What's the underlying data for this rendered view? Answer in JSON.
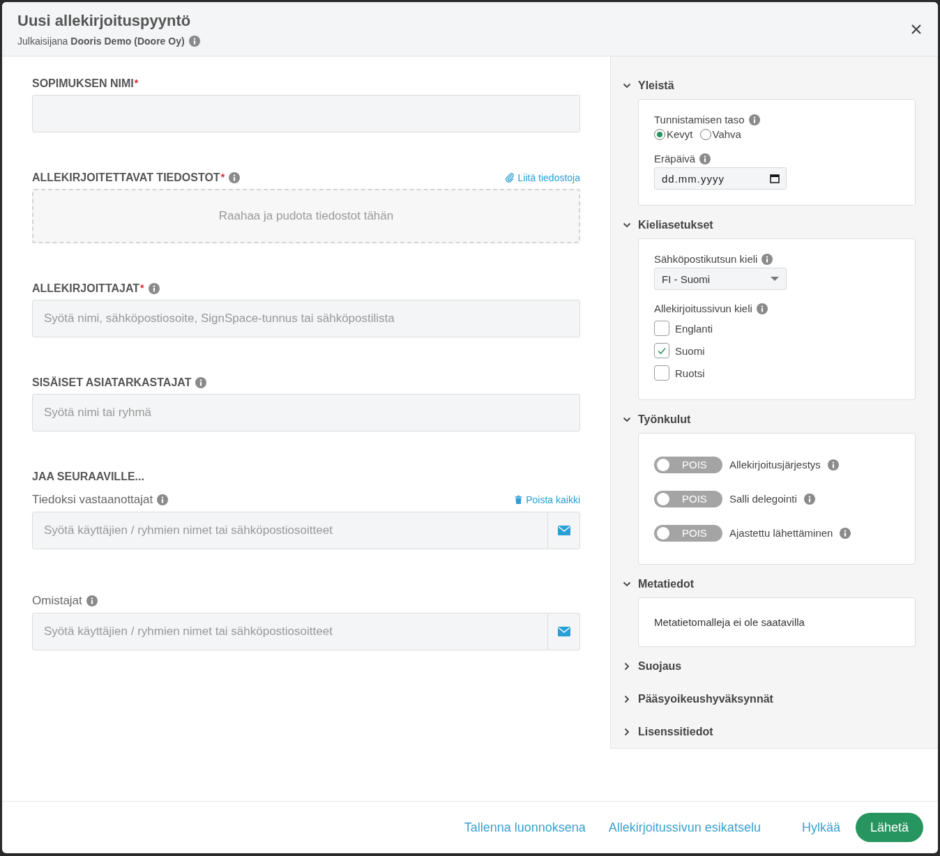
{
  "header": {
    "title": "Uusi allekirjoituspyyntö",
    "subtitle": "Julkaisijana **Dooris Demo (Doore Oy)**",
    "subtitle_info": true
  },
  "form": [
    {
      "kind": "input",
      "label": "SOPIMUKSEN NIMI",
      "required_mark": "*"
    },
    {
      "kind": "dropzone",
      "label": "ALLEKIRJOITETTAVAT TIEDOSTOT",
      "required_mark": "*",
      "info": true,
      "action": {
        "kind": "attach",
        "label": "Liitä tiedostoja"
      },
      "placeholder": "Raahaa ja pudota tiedostot tähän"
    },
    {
      "kind": "input",
      "label": "ALLEKIRJOITTAJAT",
      "required_mark": "*",
      "info": true,
      "placeholder": "Syötä nimi, sähköpostiosoite, SignSpace-tunnus tai sähköpostilista"
    },
    {
      "kind": "input",
      "label": "SISÄISET ASIATARKASTAJAT",
      "info": true,
      "placeholder": "Syötä nimi tai ryhmä"
    }
  ],
  "share": {
    "heading": "JAA SEURAAVILLE...",
    "fields": [
      {
        "label": "Tiedoksi vastaanottajat",
        "info": true,
        "action": {
          "kind": "delete",
          "label": "Poista kaikki"
        },
        "placeholder": "Syötä käyttäjien / ryhmien nimet tai sähköpostiosoitteet"
      },
      {
        "label": "Omistajat",
        "info": true,
        "placeholder": "Syötä käyttäjien / ryhmien nimet tai sähköpostiosoitteet"
      }
    ]
  },
  "sidebar": [
    {
      "title": "Yleistä",
      "expanded": true,
      "fields": [
        {
          "kind": "radio",
          "label": "Tunnistamisen taso",
          "info": true,
          "options": [
            {
              "label": "Kevyt",
              "selected": true
            },
            {
              "label": "Vahva",
              "selected": false
            }
          ]
        },
        {
          "kind": "date",
          "label": "Eräpäivä",
          "info": true,
          "placeholder": "dd.mm.yyyy"
        }
      ]
    },
    {
      "title": "Kieliasetukset",
      "expanded": true,
      "fields": [
        {
          "kind": "select",
          "label": "Sähköpostikutsun kieli",
          "info": true,
          "value": "FI - Suomi"
        },
        {
          "kind": "checkboxes",
          "label": "Allekirjoitussivun kieli",
          "info": true,
          "options": [
            {
              "label": "Englanti",
              "checked": false
            },
            {
              "label": "Suomi",
              "checked": true
            },
            {
              "label": "Ruotsi",
              "checked": false
            }
          ]
        }
      ]
    },
    {
      "title": "Työnkulut",
      "expanded": true,
      "fields": [
        {
          "kind": "toggle",
          "state_label": "POIS",
          "on": false,
          "label": "Allekirjoitusjärjestys",
          "info": true
        },
        {
          "kind": "toggle",
          "state_label": "POIS",
          "on": false,
          "label": "Salli delegointi",
          "info": true
        },
        {
          "kind": "toggle",
          "state_label": "POIS",
          "on": false,
          "label": "Ajastettu lähettäminen",
          "info": true
        }
      ]
    },
    {
      "title": "Metatiedot",
      "expanded": true,
      "fields": [
        {
          "kind": "note",
          "text": "Metatietomalleja ei ole saatavilla"
        }
      ]
    },
    {
      "title": "Suojaus",
      "expanded": false
    },
    {
      "title": "Pääsyoikeushyväksynnät",
      "expanded": false
    },
    {
      "title": "Lisenssitiedot",
      "expanded": false
    }
  ],
  "footer": [
    {
      "kind": "link",
      "label": "Tallenna luonnoksena"
    },
    {
      "kind": "link",
      "label": "Allekirjoitussivun esikatselu"
    },
    {
      "kind": "link",
      "label": "Hylkää"
    },
    {
      "kind": "primary",
      "label": "Lähetä"
    }
  ]
}
